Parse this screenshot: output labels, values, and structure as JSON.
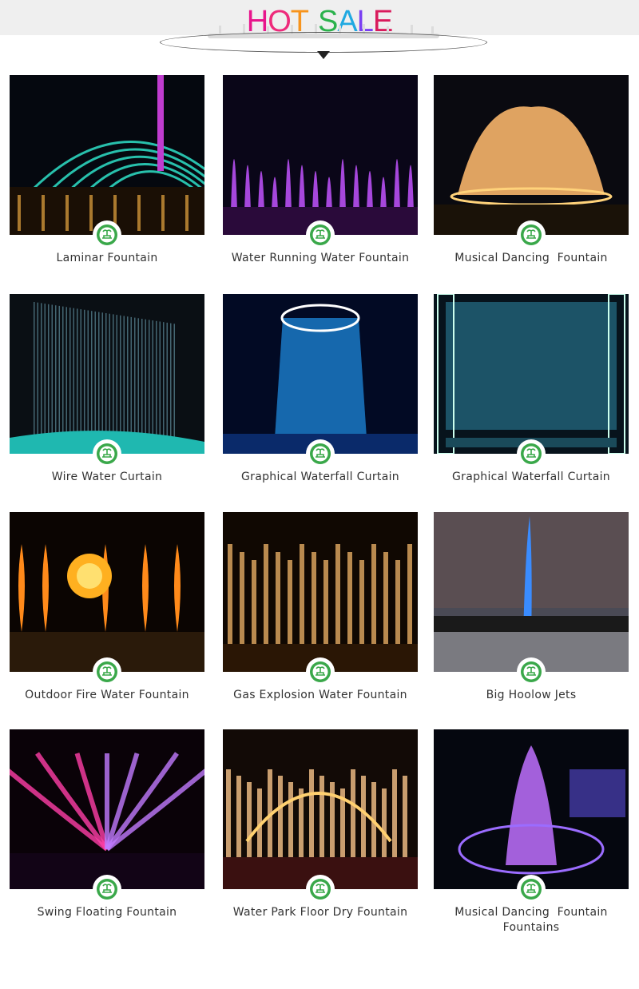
{
  "header": {
    "title_letters": [
      {
        "ch": "H",
        "color": "#e8168c"
      },
      {
        "ch": "O",
        "color": "#ee2a7b"
      },
      {
        "ch": "T",
        "color": "#f7941d"
      },
      {
        "ch": " ",
        "color": "#000000"
      },
      {
        "ch": "S",
        "color": "#2bb24c"
      },
      {
        "ch": "A",
        "color": "#1fa9e1"
      },
      {
        "ch": "L",
        "color": "#7a3ff2"
      },
      {
        "ch": "E",
        "color": "#d91b5c"
      }
    ]
  },
  "badge_color": "#3aa84a",
  "products": [
    {
      "label": "Laminar Fountain",
      "theme": "laminar"
    },
    {
      "label": "Water Running Water Fountain",
      "theme": "running"
    },
    {
      "label": "Musical Dancing  Fountain",
      "theme": "musical"
    },
    {
      "label": "Wire Water Curtain",
      "theme": "wire"
    },
    {
      "label": "Graphical Waterfall Curtain",
      "theme": "graphical-round"
    },
    {
      "label": "Graphical Waterfall Curtain",
      "theme": "graphical-frame"
    },
    {
      "label": "Outdoor Fire Water Fountain",
      "theme": "fire"
    },
    {
      "label": "Gas Explosion Water Fountain",
      "theme": "gas"
    },
    {
      "label": "Big Hoolow Jets",
      "theme": "jet"
    },
    {
      "label": "Swing Floating Fountain",
      "theme": "swing"
    },
    {
      "label": "Water Park Floor Dry Fountain",
      "theme": "park"
    },
    {
      "label": "Musical Dancing  Fountain\nFountains",
      "theme": "musical-purple"
    }
  ]
}
